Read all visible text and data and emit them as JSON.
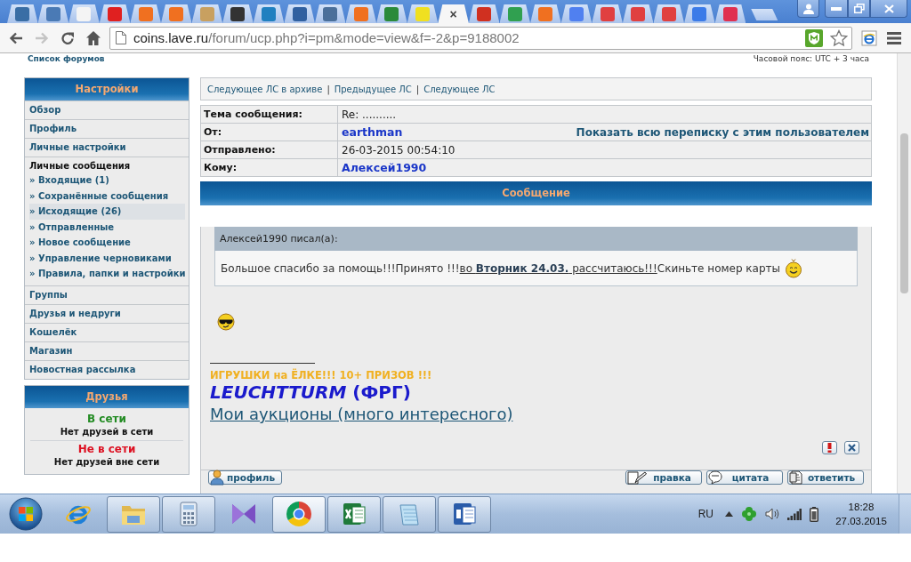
{
  "browser": {
    "tabs": [
      {
        "selected": false,
        "color": "#3a6ea5"
      },
      {
        "selected": false,
        "color": "#4a7ab5"
      },
      {
        "selected": false,
        "color": "#f4f4f4"
      },
      {
        "selected": false,
        "color": "#e02020"
      },
      {
        "selected": false,
        "color": "#f07020"
      },
      {
        "selected": false,
        "color": "#f07020"
      },
      {
        "selected": false,
        "color": "#c8a060"
      },
      {
        "selected": false,
        "color": "#333333"
      },
      {
        "selected": false,
        "color": "#2080c0"
      },
      {
        "selected": false,
        "color": "#3060a0"
      },
      {
        "selected": false,
        "color": "#4a6f9a"
      },
      {
        "selected": false,
        "color": "#f07020"
      },
      {
        "selected": false,
        "color": "#2a8a3a"
      },
      {
        "selected": false,
        "color": "#f0e020"
      },
      {
        "selected": true,
        "close": "×"
      },
      {
        "selected": false,
        "color": "#d03020"
      },
      {
        "selected": false,
        "color": "#30a050"
      },
      {
        "selected": false,
        "color": "#f07020"
      },
      {
        "selected": false,
        "color": "#5080f0"
      },
      {
        "selected": false,
        "color": "#e04040"
      },
      {
        "selected": false,
        "color": "#e04040"
      },
      {
        "selected": false,
        "color": "#e04040"
      },
      {
        "selected": false,
        "color": "#3b7be8"
      },
      {
        "selected": false,
        "color": "#e03050"
      }
    ],
    "forward_disabled": true,
    "url_host": "coins.lave.ru",
    "url_path": "/forum/ucp.php?i=pm&mode=view&f=-2&p=9188002",
    "bookmarked": false
  },
  "page": {
    "top_left": "Список форумов",
    "top_right": "Часовой пояс: UTC + 3 часа",
    "settings": {
      "title": "Настройки",
      "items": [
        {
          "label": "Обзор",
          "kind": "link",
          "selected": false
        },
        {
          "label": "Профиль",
          "kind": "link",
          "selected": false
        },
        {
          "label": "Личные настройки",
          "kind": "link",
          "selected": false
        },
        {
          "label": "Личные сообщения",
          "kind": "section",
          "selected": false,
          "children": [
            {
              "label": "» Входящие (1)",
              "selected": false
            },
            {
              "label": "» Сохранённые сообщения",
              "selected": false
            },
            {
              "label": "» Исходящие (26)",
              "selected": true
            },
            {
              "label": "» Отправленные",
              "selected": false
            },
            {
              "label": "» Новое сообщение",
              "selected": false
            },
            {
              "label": "» Управление черновиками",
              "selected": false
            },
            {
              "label": "» Правила, папки и настройки",
              "selected": false
            }
          ]
        },
        {
          "label": "Группы",
          "kind": "link",
          "selected": false
        },
        {
          "label": "Друзья и недруги",
          "kind": "link",
          "selected": false
        },
        {
          "label": "Кошелёк",
          "kind": "link",
          "selected": false
        },
        {
          "label": "Магазин",
          "kind": "link",
          "selected": false
        },
        {
          "label": "Новостная рассылка",
          "kind": "link",
          "selected": false
        }
      ]
    },
    "friends": {
      "title": "Друзья",
      "groups": [
        {
          "status": "В сети",
          "color": "#228b22",
          "note": "Нет друзей в сети"
        },
        {
          "status": "Не в сети",
          "color": "#dd1122",
          "note": "Нет друзей вне сети"
        }
      ]
    },
    "pm_nav": {
      "links": [
        "Следующее ЛС в архиве",
        "Предыдущее ЛС",
        "Следующее ЛС"
      ],
      "separator": "|"
    },
    "headers": [
      {
        "label": "Тема сообщения:",
        "value": "Re: ..........",
        "kind": "text"
      },
      {
        "label": "От:",
        "value": "earthman",
        "kind": "user",
        "extra": "Показать всю переписку с этим пользователем"
      },
      {
        "label": "Отправлено:",
        "value": "26-03-2015 00:54:10",
        "kind": "text"
      },
      {
        "label": "Кому:",
        "value": "Алексей1990",
        "kind": "user"
      }
    ],
    "message": {
      "title": "Сообщение",
      "quote": {
        "author": "Алексей1990 писал(а):",
        "before": "Большое спасибо за помощь!!!Принято !!!",
        "link": "во **Вторник 24.03.** рассчитаюсь!!!",
        "after": "Скиньте номер карты"
      },
      "signature": {
        "promo": "ИГРУШКИ на ЁЛКЕ!!! 10+ ПРИЗОВ !!!",
        "brand": "*LEUCHTTURM* (ФРГ)",
        "link": "Мои аукционы (много интересного)"
      }
    },
    "post_buttons": {
      "left": [
        {
          "label": "профиль",
          "kind": "profile"
        }
      ],
      "right": [
        {
          "label": "правка",
          "kind": "edit"
        },
        {
          "label": "цитата",
          "kind": "quote"
        },
        {
          "label": "ответить",
          "kind": "reply"
        }
      ]
    }
  },
  "taskbar": {
    "apps": [
      {
        "kind": "ie",
        "running": false,
        "selected": false
      },
      {
        "kind": "explorer",
        "running": true,
        "selected": false
      },
      {
        "kind": "calculator",
        "running": true,
        "selected": false
      },
      {
        "kind": "vs",
        "running": false,
        "selected": false
      },
      {
        "kind": "chrome",
        "running": true,
        "selected": true
      },
      {
        "kind": "excel",
        "running": true,
        "selected": false
      },
      {
        "kind": "notepad",
        "running": true,
        "selected": false
      },
      {
        "kind": "word",
        "running": true,
        "selected": false
      }
    ],
    "language": "RU",
    "time": "18:28",
    "date": "27.03.2015"
  }
}
